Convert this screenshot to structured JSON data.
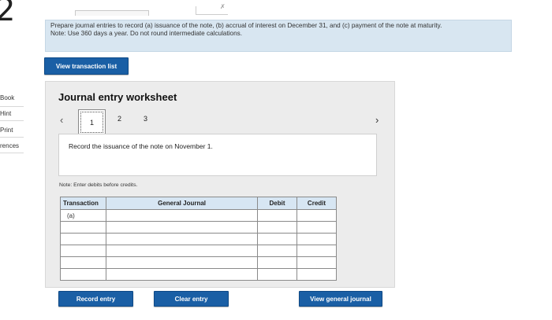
{
  "rail": {
    "question_number": "2",
    "links": [
      "Book",
      "Hint",
      "Print",
      "rences"
    ]
  },
  "top_mark": "✗",
  "instructions": {
    "text": "Prepare journal entries to record (a) issuance of the note, (b) accrual of interest on December 31, and (c) payment of the note at maturity.",
    "note": "Note: Use 360 days a year. Do not round intermediate calculations."
  },
  "view_transactions_label": "View transaction list",
  "worksheet": {
    "title": "Journal entry worksheet",
    "pages": [
      "1",
      "2",
      "3"
    ],
    "active_page": "1",
    "prev_icon": "chevron-left-icon",
    "next_icon": "chevron-right-icon",
    "record_text": "Record the issuance of the note on November 1.",
    "note": "Note: Enter debits before credits.",
    "table": {
      "headers": [
        "Transaction",
        "General Journal",
        "Debit",
        "Credit"
      ],
      "rows": [
        {
          "transaction": "(a)",
          "account": "",
          "debit": "",
          "credit": ""
        },
        {
          "transaction": "",
          "account": "",
          "debit": "",
          "credit": ""
        },
        {
          "transaction": "",
          "account": "",
          "debit": "",
          "credit": ""
        },
        {
          "transaction": "",
          "account": "",
          "debit": "",
          "credit": ""
        },
        {
          "transaction": "",
          "account": "",
          "debit": "",
          "credit": ""
        },
        {
          "transaction": "",
          "account": "",
          "debit": "",
          "credit": ""
        }
      ]
    }
  },
  "buttons": {
    "record_entry": "Record entry",
    "clear_entry": "Clear entry",
    "view_general_journal": "View general journal"
  }
}
